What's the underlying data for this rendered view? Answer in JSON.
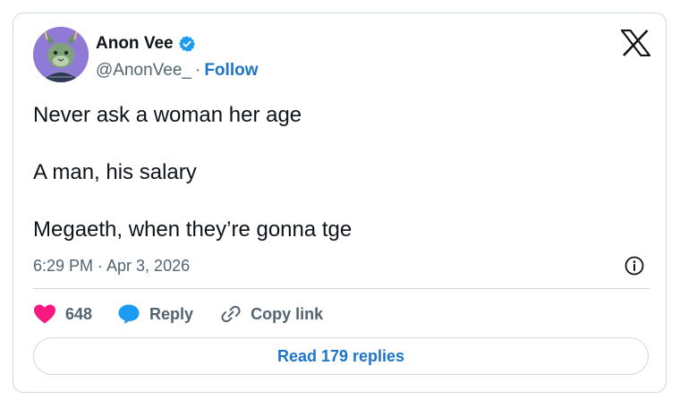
{
  "author": {
    "name": "Anon Vee",
    "handle": "@AnonVee_",
    "separator": "·",
    "follow_label": "Follow",
    "verified": true
  },
  "tweet": {
    "lines": [
      "Never ask a woman her age",
      "A man, his salary",
      "Megaeth, when they’re gonna tge"
    ],
    "timestamp": "6:29 PM · Apr 3, 2026"
  },
  "actions": {
    "likes_count": "648",
    "reply_label": "Reply",
    "copy_link_label": "Copy link"
  },
  "read_replies_label": "Read 179 replies",
  "icons": {
    "heart": "heart-icon",
    "reply": "speech-bubble-icon",
    "copy_link": "link-icon",
    "info": "info-icon",
    "logo": "x-logo-icon",
    "verified": "verified-badge-icon"
  },
  "colors": {
    "like": "#f91880",
    "reply": "#1d9bf0",
    "link_text": "#1d75c9",
    "muted": "#536471",
    "border": "#cfd9de",
    "verified": "#1d9bf0",
    "avatar_bg": "#8f7bd6"
  }
}
